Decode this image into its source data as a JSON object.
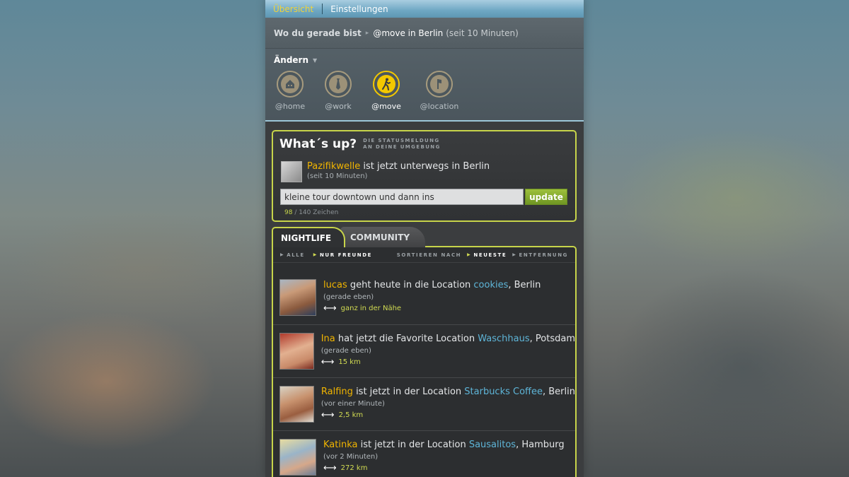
{
  "nav": {
    "active": "Übersicht",
    "settings": "Einstellungen"
  },
  "location": {
    "label": "Wo du gerade bist",
    "current": "@move in Berlin",
    "since": "(seit 10 Minuten)",
    "change_label": "Ändern",
    "places": [
      {
        "name": "@home",
        "icon": "house-icon",
        "active": false
      },
      {
        "name": "@work",
        "icon": "tie-icon",
        "active": false
      },
      {
        "name": "@move",
        "icon": "walking-person-icon",
        "active": true
      },
      {
        "name": "@location",
        "icon": "pin-icon",
        "active": false
      }
    ]
  },
  "whatsup": {
    "title": "What´s up?",
    "subtitle_line1": "DIE STATUSMELDUNG",
    "subtitle_line2": "AN DEINE UMGEBUNG",
    "user": "Pazifikwelle",
    "status": " ist jetzt unterwegs in Berlin",
    "since": "(seit 10 Minuten)",
    "input_value": "kleine tour downtown und dann ins",
    "update_label": "update",
    "count_current": "98",
    "count_rest": " / 140 Zeichen"
  },
  "tabs": {
    "nightlife": "NIGHTLIFE",
    "community": "COMMUNITY"
  },
  "filters": {
    "all": "ALLE",
    "friends": "NUR FREUNDE",
    "sort_label": "SORTIEREN NACH",
    "newest": "NEUESTE",
    "distance": "ENTFERNUNG"
  },
  "feed": [
    {
      "user": "lucas",
      "text": " geht heute in die Location ",
      "location": "cookies",
      "city": ", Berlin",
      "time": "(gerade eben)",
      "distance": "ganz in der Nähe"
    },
    {
      "user": "Ina",
      "text": " hat jetzt die Favorite Location ",
      "location": "Waschhaus",
      "city": ", Potsdam",
      "time": "(gerade eben)",
      "distance": "15 km"
    },
    {
      "user": "Ralfing",
      "text": " ist jetzt in der Location ",
      "location": "Starbucks Coffee",
      "city": ", Berlin",
      "time": "(vor einer Minute)",
      "distance": "2,5 km"
    },
    {
      "user": "Katinka",
      "text": " ist jetzt in der Location ",
      "location": "Sausalitos",
      "city": ", Hamburg",
      "time": "(vor 2 Minuten)",
      "distance": "272 km"
    }
  ],
  "colors": {
    "accent_yellow": "#f0b400",
    "frame_green": "#c7d44a",
    "link_blue": "#5eb5d8",
    "button_green": "#8bb032"
  }
}
